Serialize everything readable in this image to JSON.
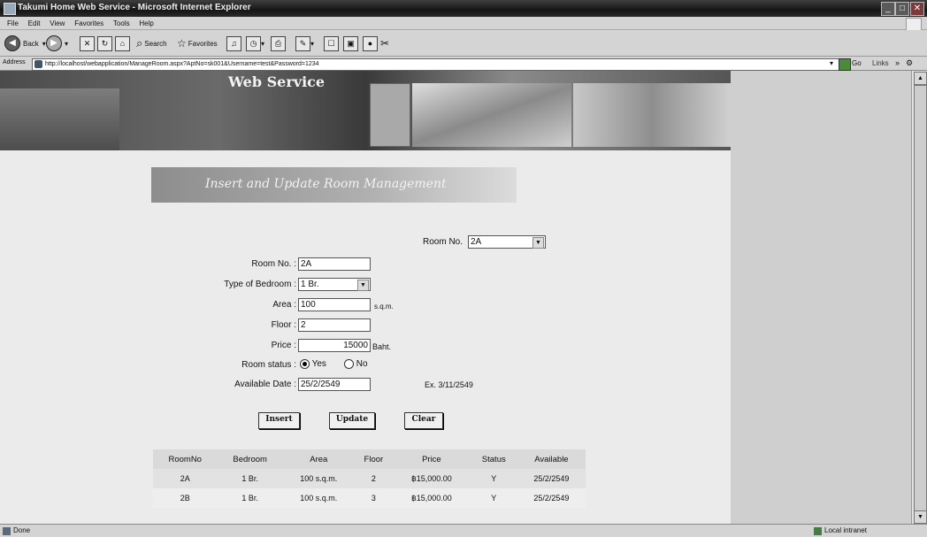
{
  "window": {
    "title": "Takumi Home Web Service - Microsoft Internet Explorer"
  },
  "menu": [
    "File",
    "Edit",
    "View",
    "Favorites",
    "Tools",
    "Help"
  ],
  "toolbar": {
    "back": "Back",
    "search": "Search",
    "favorites": "Favorites"
  },
  "address": {
    "label": "Address",
    "url": "http://localhost/webapplication/ManageRoom.aspx?AptNo=sk001&Username=test&Password=1234",
    "go": "Go",
    "links": "Links"
  },
  "banner": {
    "title": "Web Service"
  },
  "section": {
    "title": "Insert and Update Room Management"
  },
  "room_select": {
    "label": "Room No.",
    "value": "2A"
  },
  "form": {
    "room_no": {
      "label": "Room No. :",
      "value": "2A"
    },
    "bedroom": {
      "label": "Type of Bedroom :",
      "value": "1 Br."
    },
    "area": {
      "label": "Area :",
      "value": "100",
      "unit": "s.q.m."
    },
    "floor": {
      "label": "Floor :",
      "value": "2"
    },
    "price": {
      "label": "Price :",
      "value": "15000",
      "unit": "Baht."
    },
    "status": {
      "label": "Room status :",
      "yes": "Yes",
      "no": "No",
      "selected": "Yes"
    },
    "date": {
      "label": "Available Date :",
      "value": "25/2/2549",
      "example": "Ex. 3/11/2549"
    }
  },
  "buttons": {
    "insert": "Insert",
    "update": "Update",
    "clear": "Clear"
  },
  "table": {
    "headers": [
      "RoomNo",
      "Bedroom",
      "Area",
      "Floor",
      "Price",
      "Status",
      "Available"
    ],
    "rows": [
      [
        "2A",
        "1 Br.",
        "100 s.q.m.",
        "2",
        "฿15,000.00",
        "Y",
        "25/2/2549"
      ],
      [
        "2B",
        "1 Br.",
        "100 s.q.m.",
        "3",
        "฿15,000.00",
        "Y",
        "25/2/2549"
      ]
    ]
  },
  "statusbar": {
    "left": "Done",
    "zone": "Local intranet"
  }
}
